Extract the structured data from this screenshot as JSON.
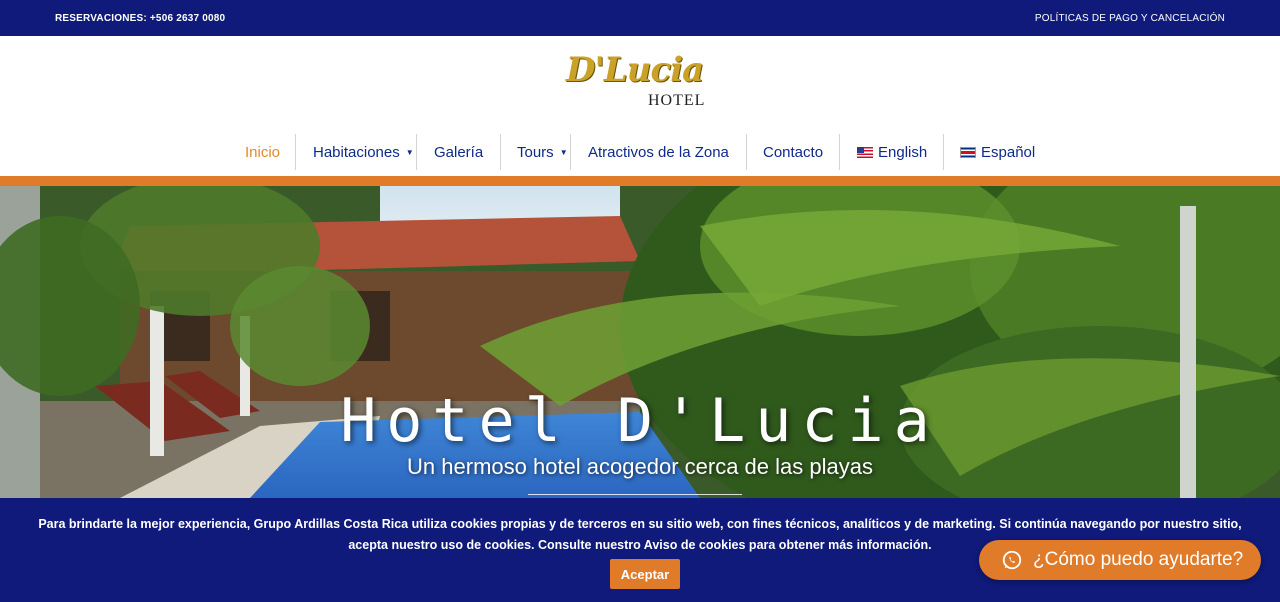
{
  "topbar": {
    "reservations_label": "RESERVACIONES:",
    "reservations_phone": "+506 2637 0080",
    "policies_link": "POLÍTICAS DE PAGO Y CANCELACIÓN"
  },
  "logo": {
    "script_text": "D'Lucia",
    "sub_text": "HOTEL"
  },
  "nav": {
    "items": [
      {
        "label": "Inicio",
        "active": true
      },
      {
        "label": "Habitaciones",
        "dropdown": true
      },
      {
        "label": "Galería"
      },
      {
        "label": "Tours",
        "dropdown": true
      },
      {
        "label": "Atractivos de la Zona"
      },
      {
        "label": "Contacto"
      },
      {
        "label": "English",
        "flag": "us-flag-icon"
      },
      {
        "label": "Español",
        "flag": "costa-rica-flag-icon"
      }
    ]
  },
  "hero": {
    "title": "Hotel D'Lucia",
    "subtitle": "Un hermoso hotel acogedor cerca de las playas"
  },
  "cookie": {
    "line1": "Para brindarte la mejor experiencia, Grupo Ardillas Costa Rica utiliza cookies propias y de terceros en su sitio web, con fines técnicos, analíticos y de marketing. Si continúa navegando por nuestro sitio,",
    "line2": "acepta nuestro uso de cookies. Consulte nuestro Aviso de cookies para obtener más información.",
    "accept_label": "Aceptar"
  },
  "whatsapp": {
    "label": "¿Cómo puedo ayudarte?",
    "icon": "whatsapp-icon"
  },
  "colors": {
    "brand_navy": "#0f1a7a",
    "accent_orange": "#e07b2a",
    "nav_blue": "#0f2a8a",
    "logo_gold": "#c9a227"
  }
}
